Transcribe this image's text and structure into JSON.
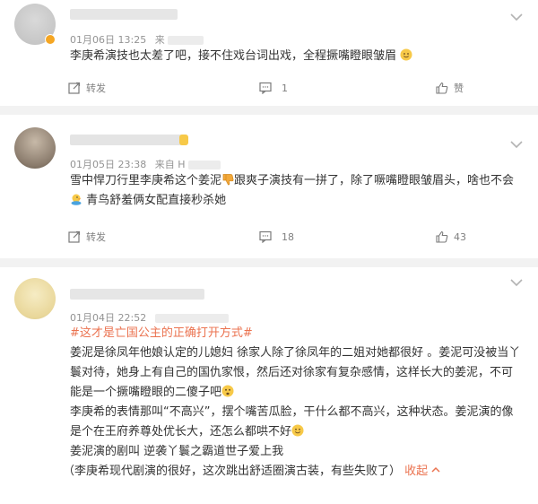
{
  "colors": {
    "accent": "#eb7350",
    "meta": "#939393",
    "text": "#333333",
    "separator": "#f2f2f2"
  },
  "posts": [
    {
      "date": "01月06日 13:25",
      "source_prefix": "来",
      "lines": [
        "李庚希演技也太差了吧，接不住戏台词出戏，全程撅嘴瞪眼皱眉"
      ],
      "repost": "转发",
      "comments": "1",
      "likes": "赞"
    },
    {
      "date": "01月05日 23:38",
      "source_prefix": "来自 H",
      "line1_a": "雪中悍刀行里李庚希这个姜泥",
      "line1_b": "跟爽子演技有一拼了，除了噘嘴瞪眼皱眉头，啥也不会",
      "line2": "青鸟舒羞俩女配直接秒杀她",
      "repost": "转发",
      "comments": "18",
      "likes": "43"
    },
    {
      "date": "01月04日 22:52",
      "tag": "#这才是亡国公主的正确打开方式#",
      "lines": [
        "姜泥是徐凤年他娘认定的儿媳妇 徐家人除了徐凤年的二姐对她都很好 。姜泥可没被当丫",
        "鬟对待，她身上有自己的国仇家恨，然后还对徐家有复杂感情，这样长大的姜泥，不可",
        "能是一个撅嘴瞪眼的二傻子吧",
        "李庚希的表情那叫“不高兴”，摆个嘴苦瓜脸，干什么都不高兴，这种状态。姜泥演的像",
        "是个在王府养尊处优长大，还怎么都哄不好",
        "姜泥演的剧叫 逆袭丫鬟之霸道世子爱上我"
      ],
      "last_line": "（李庚希现代剧演的很好，这次跳出舒适圈演古装，有些失败了）",
      "fold": "收起"
    }
  ]
}
